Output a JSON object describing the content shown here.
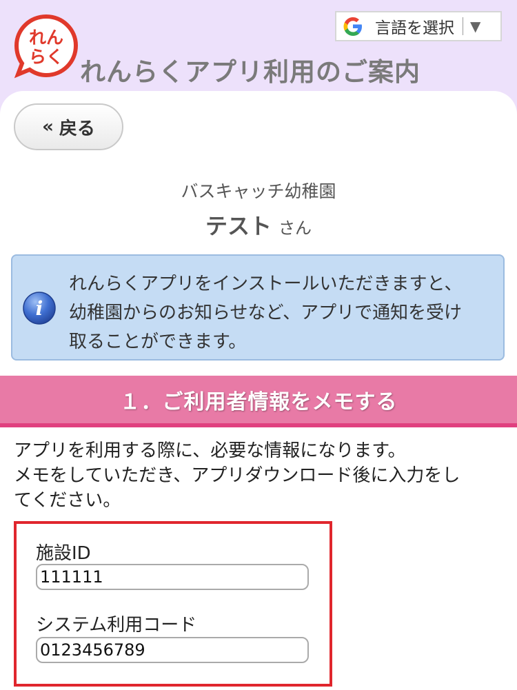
{
  "header": {
    "logo_line1": "れん",
    "logo_line2": "らく",
    "app_title": "れんらくアプリ利用のご案内",
    "translate_label": "言語を選択",
    "translate_arrow": "▼"
  },
  "nav": {
    "back_chevron": "«",
    "back_label": "戻る"
  },
  "user": {
    "facility_name": "バスキャッチ幼稚園",
    "user_name": "テスト",
    "honorific": "さん"
  },
  "info": {
    "icon_letter": "i",
    "lines": [
      "れんらくアプリをインストールいただきますと、",
      "幼稚園からのお知らせなど、アプリで通知を受け",
      "取ることができます。"
    ]
  },
  "section1": {
    "title": "１．ご利用者情報をメモする",
    "desc_lines": [
      "アプリを利用する際に、必要な情報になります。",
      "メモをしていただき、アプリダウンロード後に入力をし",
      "てください。"
    ],
    "facility_id_label": "施設ID",
    "facility_id_value": "111111",
    "system_code_label": "システム利用コード",
    "system_code_value": "0123456789"
  },
  "colors": {
    "header_bg": "#ede1fb",
    "logo_red": "#e0392b",
    "section_pink": "#e87aa6",
    "section_border": "#e0407f",
    "info_bg": "#c5dcf4",
    "highlight_red": "#e0262d"
  },
  "icons": {
    "logo": "renraku-logo-bubble",
    "translate": "google-g-icon",
    "info": "info-icon",
    "back": "double-chevron-left-icon"
  }
}
